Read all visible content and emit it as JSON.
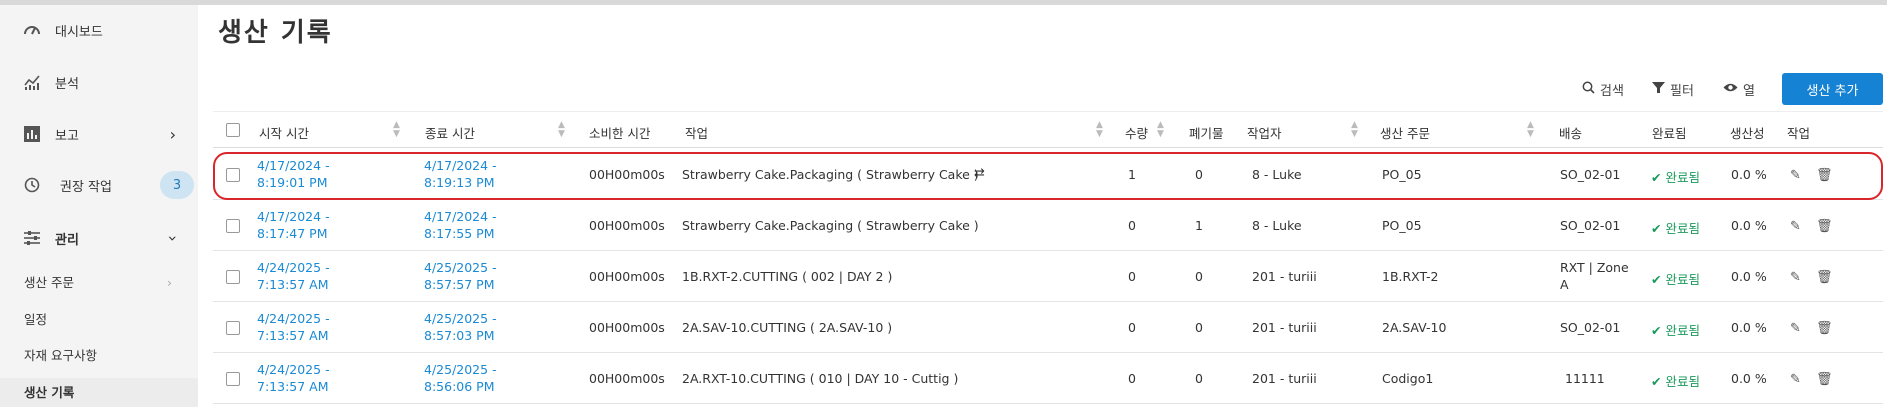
{
  "sidebar": {
    "items": [
      {
        "label": "대시보드",
        "icon": "dashboard-gauge-icon"
      },
      {
        "label": "분석",
        "icon": "analytics-chart-icon"
      },
      {
        "label": "보고",
        "icon": "report-bar-icon"
      },
      {
        "label": "권장 작업",
        "icon": "history-clock-icon",
        "badge": "3"
      },
      {
        "label": "관리",
        "icon": "sliders-icon"
      }
    ],
    "subitems": [
      {
        "label": "생산 주문"
      },
      {
        "label": "일정"
      },
      {
        "label": "자재 요구사항"
      },
      {
        "label": "생산 기록"
      }
    ]
  },
  "page": {
    "title": "생산 기록"
  },
  "toolbar": {
    "search": "검색",
    "filter": "필터",
    "columns": "열",
    "add": "생산 추가"
  },
  "table": {
    "headers": {
      "start": "시작 시간",
      "end": "종료 시간",
      "elapsed": "소비한 시간",
      "job": "작업",
      "qty": "수량",
      "scrap": "폐기물",
      "worker": "작업자",
      "order": "생산 주문",
      "shipping": "배송",
      "complete": "완료됨",
      "productivity": "생산성",
      "actions": "작업"
    },
    "rows": [
      {
        "start1": "4/17/2024 -",
        "start2": "8:19:01 PM",
        "end1": "4/17/2024 -",
        "end2": "8:19:13 PM",
        "elapsed": "00H00m00s",
        "job": "Strawberry Cake.Packaging ( Strawberry Cake )",
        "qty": "1",
        "scrap": "0",
        "worker": "8 - Luke",
        "order": "PO_05",
        "ship1": "SO_02-01",
        "ship2": "",
        "complete": "완료됨",
        "prod": "0.0 %"
      },
      {
        "start1": "4/17/2024 -",
        "start2": "8:17:47 PM",
        "end1": "4/17/2024 -",
        "end2": "8:17:55 PM",
        "elapsed": "00H00m00s",
        "job": "Strawberry Cake.Packaging ( Strawberry Cake )",
        "qty": "0",
        "scrap": "1",
        "worker": "8 - Luke",
        "order": "PO_05",
        "ship1": "SO_02-01",
        "ship2": "",
        "complete": "완료됨",
        "prod": "0.0 %"
      },
      {
        "start1": "4/24/2025 -",
        "start2": "7:13:57 AM",
        "end1": "4/25/2025 -",
        "end2": "8:57:57 PM",
        "elapsed": "00H00m00s",
        "job": "1B.RXT-2.CUTTING ( 002 | DAY 2 )",
        "qty": "0",
        "scrap": "0",
        "worker": "201 - turiii",
        "order": "1B.RXT-2",
        "ship1": "RXT | Zone",
        "ship2": "A",
        "complete": "완료됨",
        "prod": "0.0 %"
      },
      {
        "start1": "4/24/2025 -",
        "start2": "7:13:57 AM",
        "end1": "4/25/2025 -",
        "end2": "8:57:03 PM",
        "elapsed": "00H00m00s",
        "job": "2A.SAV-10.CUTTING ( 2A.SAV-10 )",
        "qty": "0",
        "scrap": "0",
        "worker": "201 - turiii",
        "order": "2A.SAV-10",
        "ship1": "SO_02-01",
        "ship2": "",
        "complete": "완료됨",
        "prod": "0.0 %"
      },
      {
        "start1": "4/24/2025 -",
        "start2": "7:13:57 AM",
        "end1": "4/25/2025 -",
        "end2": "8:56:06 PM",
        "elapsed": "00H00m00s",
        "job": "2A.RXT-10.CUTTING ( 010 | DAY 10 - Cuttig )",
        "qty": "0",
        "scrap": "0",
        "worker": "201 - turiii",
        "order": "Codigo1",
        "ship1": "11111",
        "ship2": "",
        "complete": "완료됨",
        "prod": "0.0 %"
      }
    ]
  },
  "colors": {
    "accent": "#1582d4",
    "link": "#1a8ad4",
    "done": "#1a9a5a",
    "highlight": "#d9262c"
  }
}
